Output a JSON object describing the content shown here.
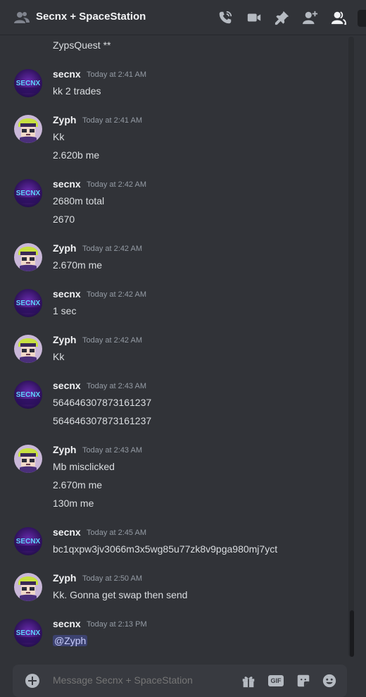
{
  "header": {
    "title": "Secnx + SpaceStation",
    "icons": {
      "dm": "users-icon",
      "call": "phone-call-icon",
      "video": "video-icon",
      "pin": "pin-icon",
      "add": "add-user-icon",
      "members": "members-icon"
    }
  },
  "top_line": "ZypsQuest **",
  "messages": [
    {
      "author": "secnx",
      "avatar": "secnx",
      "time": "Today at 2:41 AM",
      "lines": [
        "kk 2 trades"
      ]
    },
    {
      "author": "Zyph",
      "avatar": "zyph",
      "time": "Today at 2:41 AM",
      "lines": [
        "Kk",
        "2.620b me"
      ]
    },
    {
      "author": "secnx",
      "avatar": "secnx",
      "time": "Today at 2:42 AM",
      "lines": [
        "2680m total",
        "2670"
      ]
    },
    {
      "author": "Zyph",
      "avatar": "zyph",
      "time": "Today at 2:42 AM",
      "lines": [
        "2.670m me"
      ]
    },
    {
      "author": "secnx",
      "avatar": "secnx",
      "time": "Today at 2:42 AM",
      "lines": [
        "1 sec"
      ]
    },
    {
      "author": "Zyph",
      "avatar": "zyph",
      "time": "Today at 2:42 AM",
      "lines": [
        "Kk"
      ]
    },
    {
      "author": "secnx",
      "avatar": "secnx",
      "time": "Today at 2:43 AM",
      "lines": [
        "564646307873161237",
        "564646307873161237"
      ]
    },
    {
      "author": "Zyph",
      "avatar": "zyph",
      "time": "Today at 2:43 AM",
      "lines": [
        "Mb misclicked",
        "2.670m me",
        "130m me"
      ]
    },
    {
      "author": "secnx",
      "avatar": "secnx",
      "time": "Today at 2:45 AM",
      "lines": [
        "bc1qxpw3jv3066m3x5wg85u77zk8v9pga980mj7yct"
      ]
    },
    {
      "author": "Zyph",
      "avatar": "zyph",
      "time": "Today at 2:50 AM",
      "lines": [
        "Kk. Gonna get swap then send"
      ]
    },
    {
      "author": "secnx",
      "avatar": "secnx",
      "time": "Today at 2:13 PM",
      "lines": [
        "@Zyph"
      ],
      "mention": true
    }
  ],
  "avatar_text": {
    "secnx": "SECNX"
  },
  "composer": {
    "placeholder": "Message Secnx + SpaceStation",
    "gif_label": "GIF"
  },
  "colors": {
    "background": "#313338",
    "composer": "#383a40",
    "mention": "#3c4270",
    "secnx_avatar": "#3b1a6e",
    "zyph_hair": "#c8e040"
  }
}
